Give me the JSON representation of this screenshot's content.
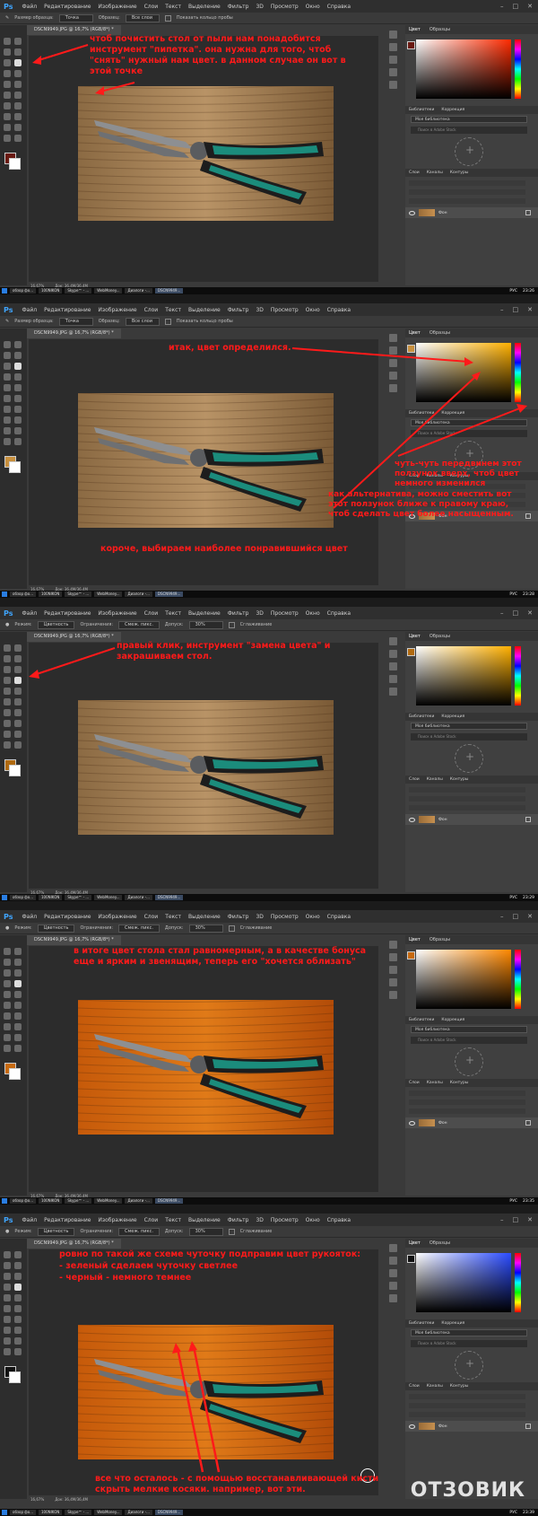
{
  "menu": {
    "logo": "Ps",
    "items": [
      "Файл",
      "Редактирование",
      "Изображение",
      "Слои",
      "Текст",
      "Выделение",
      "Фильтр",
      "3D",
      "Просмотр",
      "Окно",
      "Справка"
    ],
    "window_controls": [
      "–",
      "□",
      "✕"
    ]
  },
  "document": {
    "tab_title": "DSCN9949.JPG @ 16,7% (RGB/8*) *",
    "zoom": "16,67%",
    "doc_size": "Док: 36,4M/36,4M"
  },
  "option_bars": {
    "eyedropper": {
      "sample_size_label": "Размер образца:",
      "sample_size": "Точка",
      "sample_label": "Образец:",
      "sample": "Все слои",
      "ring_label": "Показать кольцо пробы"
    },
    "color_replace": {
      "mode_label": "Режим:",
      "mode": "Цветность",
      "limits_label": "Ограничения:",
      "limits": "Смеж. пикс.",
      "tolerance_label": "Допуск:",
      "tolerance": "30%",
      "smoothing_label": "Сглаживание"
    }
  },
  "panels": {
    "color_tabs": [
      "Цвет",
      "Образцы"
    ],
    "library_tabs": [
      "Библиотеки",
      "Коррекция"
    ],
    "library_select": "Моя библиотека",
    "library_search": "Поиск в Adobe Stock",
    "layers_tabs": [
      "Слои",
      "Каналы",
      "Контуры"
    ],
    "layer_name": "Фон"
  },
  "taskbar": {
    "items": [
      "обзор фо...",
      "100NIKON",
      "Skype™ - ...",
      "WebMoney...",
      "Диалоги -...",
      "DSCN9949..."
    ],
    "lang": "РУС",
    "times": [
      "23:26",
      "23:28",
      "23:29",
      "23:35",
      "23:39",
      "23:43"
    ]
  },
  "frames": [
    {
      "swatch": "#6a1a12",
      "photo": "natural",
      "color_box_hue": "#ff2a00",
      "annotations": [
        "чтоб почистить стол от пыли нам понадобится инструмент \"пипетка\". она нужна для того, чтоб \"снять\" нужный нам цвет. в данном случае он вот в этой точке"
      ]
    },
    {
      "swatch": "#c8903e",
      "photo": "natural",
      "color_box_hue": "#ffb000",
      "annotations": [
        "итак, цвет определился.",
        "чуть-чуть передвинем этот ползунок вверх, чтоб цвет немного изменился",
        "как альтернатива, можно сместить вот этот ползунок ближе к правому краю, чтоб сделать цвет более насыщенным.",
        "короче, выбираем наиболее понравившийся цвет"
      ]
    },
    {
      "swatch": "#b06a10",
      "photo": "natural",
      "color_box_hue": "#ffb000",
      "annotations": [
        "правый клик, инструмент \"замена цвета\" и закрашиваем стол."
      ]
    },
    {
      "swatch": "#c76a10",
      "photo": "orange",
      "color_box_hue": "#ff8800",
      "annotations": [
        "в итоге цвет стола стал равномерным, а в качестве бонуса еще и ярким и звенящим, теперь его \"хочется облизать\""
      ]
    },
    {
      "swatch": "#111111",
      "photo": "orange",
      "color_box_hue": "#2a4bff",
      "annotations": [
        "ровно по такой же схеме чуточку подправим цвет рукояток:",
        "- зеленый сделаем чуточку светлее",
        "- черный - немного темнее",
        "все что осталось - с помощью восстанавливающей кисти скрыть мелкие косяки. например, вот эти."
      ]
    }
  ],
  "watermark": "ОТЗОВИК",
  "colors": {
    "annotation": "#ff1a1a",
    "ui_dark": "#2d2d2d",
    "ui_panel": "#404040"
  }
}
